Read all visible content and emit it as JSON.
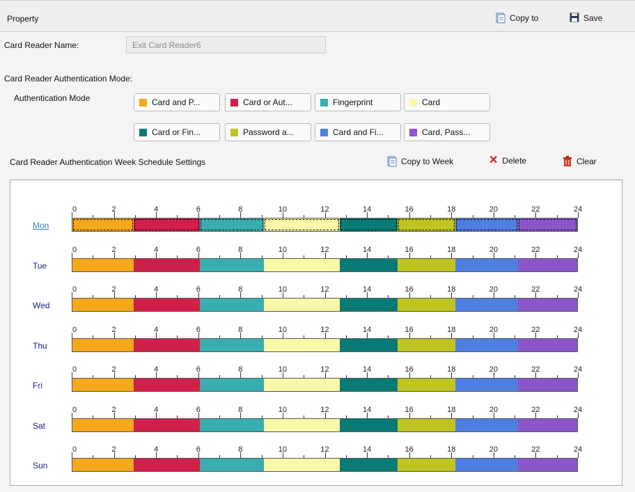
{
  "header": {
    "title": "Property",
    "copy_to": "Copy to",
    "save": "Save"
  },
  "card_reader": {
    "name_label": "Card Reader Name:",
    "name_value": "Exit Card Reader6"
  },
  "auth": {
    "section_label": "Card Reader Authentication Mode:",
    "mode_label": "Authentication Mode",
    "modes": [
      {
        "label": "Card and P...",
        "color": "#f5a81c"
      },
      {
        "label": "Card or Aut...",
        "color": "#d0204a"
      },
      {
        "label": "Fingerprint",
        "color": "#3aadb0"
      },
      {
        "label": "Card",
        "color": "#fbf7a8"
      },
      {
        "label": "Card or Fin...",
        "color": "#0a7a76"
      },
      {
        "label": "Password a...",
        "color": "#bfc421"
      },
      {
        "label": "Card and Fi...",
        "color": "#4e7fe0"
      },
      {
        "label": "Card, Pass...",
        "color": "#8b56c8"
      }
    ]
  },
  "schedule": {
    "title": "Card Reader Authentication Week Schedule Settings",
    "copy_to_week": "Copy to Week",
    "delete": "Delete",
    "clear": "Clear",
    "hour_labels": [
      "0",
      "2",
      "4",
      "6",
      "8",
      "10",
      "12",
      "14",
      "16",
      "18",
      "20",
      "22",
      "24"
    ],
    "days": [
      "Mon",
      "Tue",
      "Wed",
      "Thu",
      "Fri",
      "Sat",
      "Sun"
    ],
    "active_day": "Mon",
    "segments_hours": [
      {
        "start": 0,
        "end": 2.9,
        "mode": 0
      },
      {
        "start": 2.9,
        "end": 6.05,
        "mode": 1
      },
      {
        "start": 6.05,
        "end": 9.1,
        "mode": 2
      },
      {
        "start": 9.1,
        "end": 12.7,
        "mode": 3
      },
      {
        "start": 12.7,
        "end": 15.45,
        "mode": 4
      },
      {
        "start": 15.45,
        "end": 18.2,
        "mode": 5
      },
      {
        "start": 18.2,
        "end": 21.2,
        "mode": 6
      },
      {
        "start": 21.2,
        "end": 24,
        "mode": 7
      }
    ]
  }
}
